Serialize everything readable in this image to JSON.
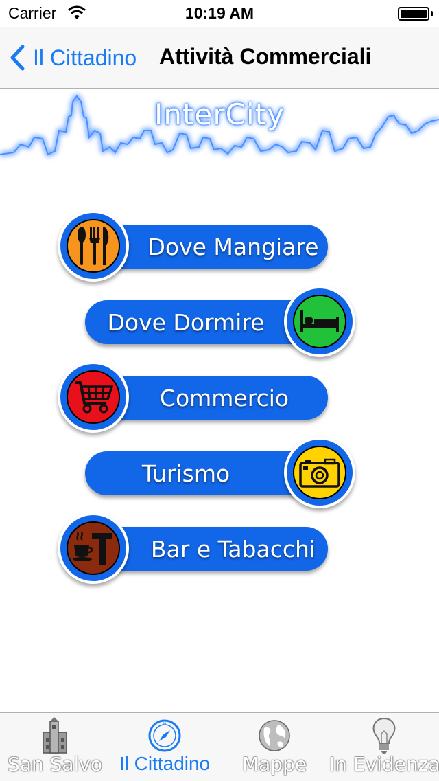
{
  "status_bar": {
    "carrier": "Carrier",
    "time": "10:19 AM"
  },
  "nav": {
    "back_label": "Il Cittadino",
    "title": "Attività Commerciali"
  },
  "banner": {
    "logo_text": "InterCity"
  },
  "menu": [
    {
      "label": "Dove Mangiare",
      "icon": "cutlery-icon",
      "color": "#f7941d"
    },
    {
      "label": "Dove Dormire",
      "icon": "bed-icon",
      "color": "#22c13a"
    },
    {
      "label": "Commercio",
      "icon": "shopping-cart-icon",
      "color": "#e8101a"
    },
    {
      "label": "Turismo",
      "icon": "camera-icon",
      "color": "#ffd200"
    },
    {
      "label": "Bar e Tabacchi",
      "icon": "coffee-tobacco-icon",
      "color": "#8b2a0c"
    }
  ],
  "tabs": [
    {
      "label": "San Salvo",
      "icon": "tower-icon",
      "active": false
    },
    {
      "label": "Il Cittadino",
      "icon": "compass-icon",
      "active": true
    },
    {
      "label": "Mappe",
      "icon": "globe-icon",
      "active": false
    },
    {
      "label": "In Evidenza",
      "icon": "lightbulb-icon",
      "active": false
    }
  ],
  "colors": {
    "accent": "#1a7cf4",
    "button_blue": "#1267e8"
  }
}
